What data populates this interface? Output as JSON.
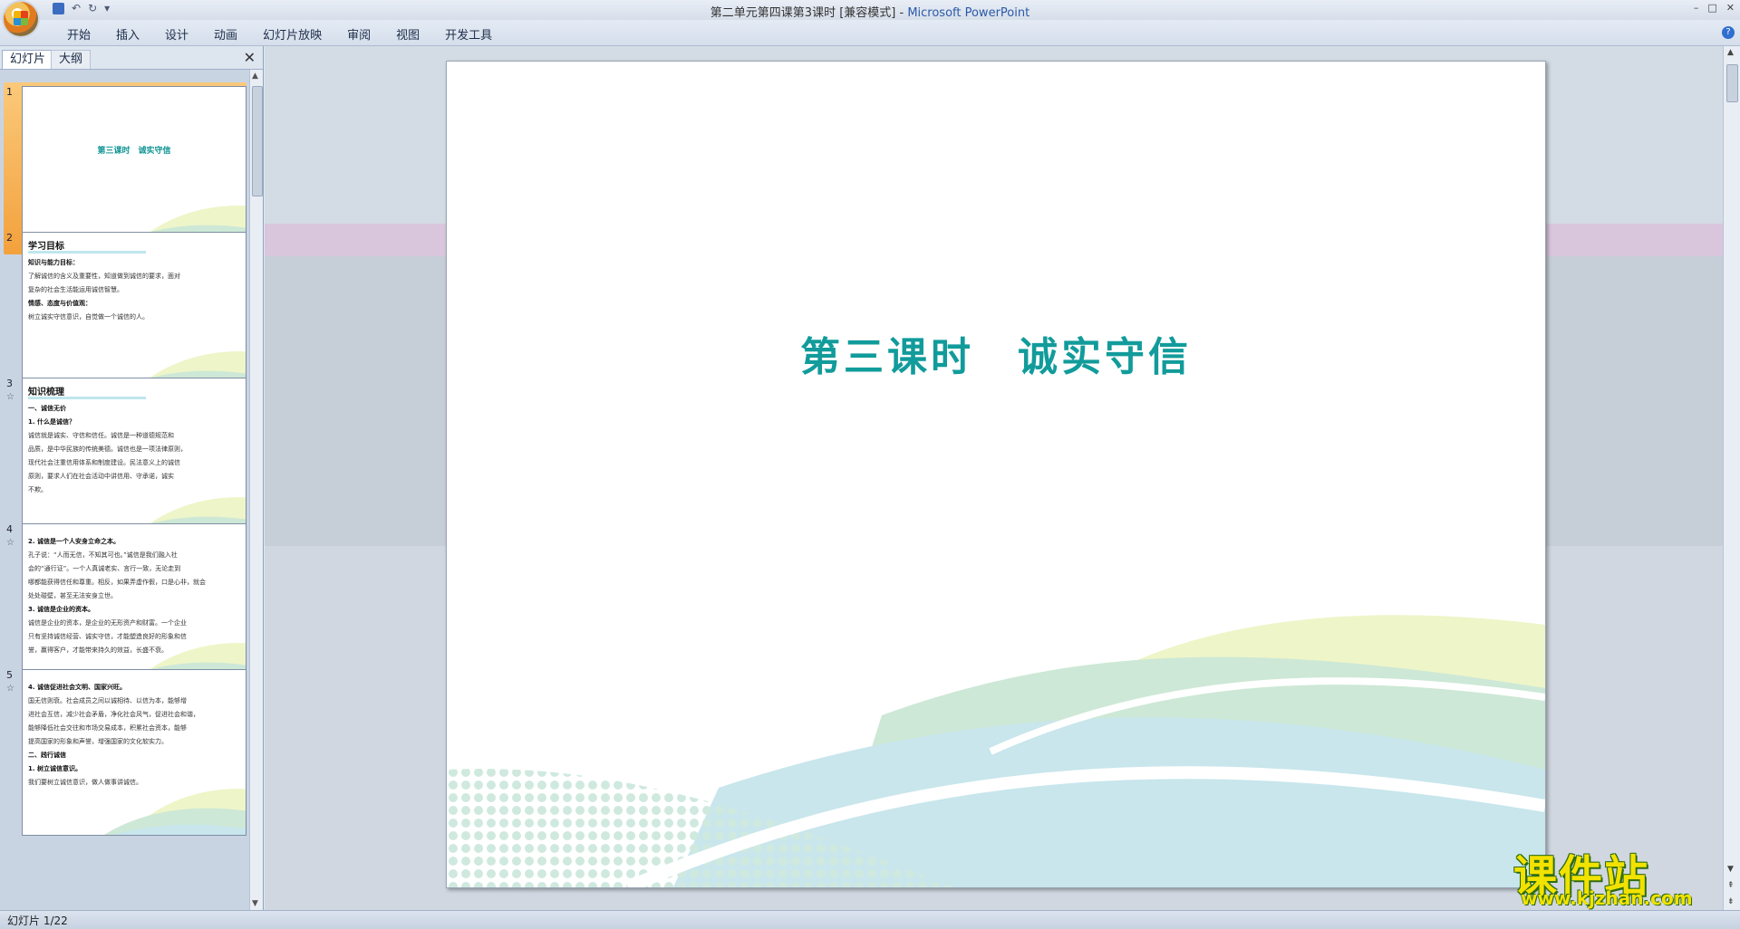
{
  "window": {
    "title_doc": "第二单元第四课第3课时 [兼容模式] - ",
    "title_app": "Microsoft PowerPoint",
    "minimize": "–",
    "maximize": "□",
    "close": "✕"
  },
  "ribbon": {
    "tabs": [
      "开始",
      "插入",
      "设计",
      "动画",
      "幻灯片放映",
      "审阅",
      "视图",
      "开发工具"
    ],
    "help": "?"
  },
  "left_pane": {
    "tab_slides": "幻灯片",
    "tab_outline": "大纲",
    "close": "✕"
  },
  "thumbnails": [
    {
      "num": "1",
      "title": "第三课时　诚实守信"
    },
    {
      "num": "2",
      "heading": "学习目标",
      "lines": [
        {
          "t": "知识与能力目标：",
          "cls": "b"
        },
        {
          "t": "了解诚信的含义及重要性，知道做到诚信的要求，面对",
          "cls": ""
        },
        {
          "t": "复杂的社会生活能运用诚信智慧。",
          "cls": ""
        },
        {
          "t": "情感、态度与价值观：",
          "cls": "b"
        },
        {
          "t": "树立诚实守信意识，自觉做一个诚信的人。",
          "cls": ""
        }
      ]
    },
    {
      "num": "3",
      "star": "☆",
      "heading": "知识梳理",
      "lines": [
        {
          "t": "一、诚信无价",
          "cls": "b"
        },
        {
          "t": "1. 什么是诚信？",
          "cls": "b"
        },
        {
          "t": "诚信就是诚实、守信和信任。诚信是一种道德规范和",
          "cls": ""
        },
        {
          "t": "品质，是中华民族的传统美德。诚信也是一项法律原则，",
          "cls": ""
        },
        {
          "t": "现代社会注重信用体系和制度建设。民法意义上的诚信",
          "cls": ""
        },
        {
          "t": "原则，要求人们在社会活动中讲信用、守承诺，诚实",
          "cls": ""
        },
        {
          "t": "不欺。",
          "cls": ""
        }
      ]
    },
    {
      "num": "4",
      "star": "☆",
      "lines": [
        {
          "t": "2. 诚信是一个人安身立命之本。",
          "cls": "b"
        },
        {
          "t": "孔子说：“人而无信，不知其可也。”诚信是我们融入社",
          "cls": ""
        },
        {
          "t": "会的“通行证”。一个人真诚老实、言行一致，无论走到",
          "cls": ""
        },
        {
          "t": "哪都能获得信任和尊重。相反，如果弄虚作假，口是心非，就会",
          "cls": ""
        },
        {
          "t": "处处碰壁，甚至无法安身立世。",
          "cls": ""
        },
        {
          "t": "3. 诚信是企业的资本。",
          "cls": "b"
        },
        {
          "t": "诚信是企业的资本，是企业的无形资产和财富。一个企业",
          "cls": ""
        },
        {
          "t": "只有坚持诚信经营、诚实守信，才能塑造良好的形象和信",
          "cls": ""
        },
        {
          "t": "誉，赢得客户，才能带来持久的效益，长盛不衰。",
          "cls": ""
        }
      ]
    },
    {
      "num": "5",
      "star": "☆",
      "lines": [
        {
          "t": "4. 诚信促进社会文明、国家兴旺。",
          "cls": "b"
        },
        {
          "t": "国无信则衰。社会成员之间以诚相待、以信为本，能够增",
          "cls": ""
        },
        {
          "t": "进社会互信，减少社会矛盾，净化社会风气，促进社会和谐，",
          "cls": ""
        },
        {
          "t": "能够降低社会交往和市场交易成本，积累社会资本，能够",
          "cls": ""
        },
        {
          "t": "提高国家的形象和声誉，增强国家的文化软实力。",
          "cls": ""
        },
        {
          "t": "二、践行诚信",
          "cls": "b"
        },
        {
          "t": "1. 树立诚信意识。",
          "cls": "b"
        },
        {
          "t": "我们要树立诚信意识，做人做事讲诚信。",
          "cls": ""
        }
      ]
    }
  ],
  "slide": {
    "title": "第三课时　诚实守信"
  },
  "status": {
    "text": "幻灯片 1/22"
  },
  "watermark": {
    "big": "课件站",
    "small": "www.kjzhan.com"
  },
  "colors": {
    "title_teal": "#129b9b",
    "selected_orange": "#f3a13c",
    "watermark_yellow": "#f2e200"
  }
}
